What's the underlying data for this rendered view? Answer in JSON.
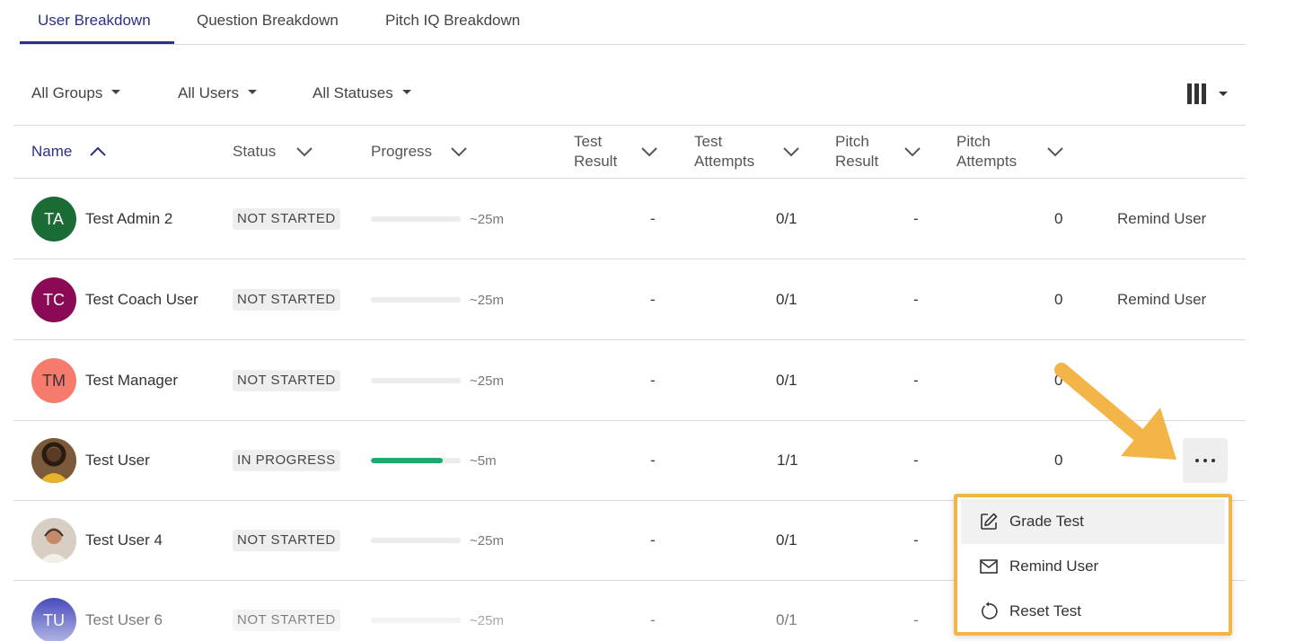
{
  "tabs": [
    {
      "label": "User Breakdown",
      "active": true
    },
    {
      "label": "Question Breakdown",
      "active": false
    },
    {
      "label": "Pitch IQ Breakdown",
      "active": false
    }
  ],
  "filters": {
    "groups": "All Groups",
    "users": "All Users",
    "statuses": "All Statuses"
  },
  "columns": {
    "name": "Name",
    "status": "Status",
    "progress": "Progress",
    "test_result_1": "Test",
    "test_result_2": "Result",
    "test_attempts_1": "Test",
    "test_attempts_2": "Attempts",
    "pitch_result_1": "Pitch",
    "pitch_result_2": "Result",
    "pitch_attempts_1": "Pitch",
    "pitch_attempts_2": "Attempts"
  },
  "rows": [
    {
      "initials": "TA",
      "name": "Test Admin 2",
      "avatar_color": "#1b6b34",
      "status": "NOT STARTED",
      "progress": 0,
      "time": "~25m",
      "test_result": "-",
      "test_attempts": "0/1",
      "pitch_result": "-",
      "pitch_attempts": "0",
      "action": "Remind User"
    },
    {
      "initials": "TC",
      "name": "Test Coach User",
      "avatar_color": "#8a0a55",
      "status": "NOT STARTED",
      "progress": 0,
      "time": "~25m",
      "test_result": "-",
      "test_attempts": "0/1",
      "pitch_result": "-",
      "pitch_attempts": "0",
      "action": "Remind User"
    },
    {
      "initials": "TM",
      "name": "Test Manager",
      "avatar_color": "#f77b6c",
      "status": "NOT STARTED",
      "progress": 0,
      "time": "~25m",
      "test_result": "-",
      "test_attempts": "0/1",
      "pitch_result": "-",
      "pitch_attempts": "0",
      "action": ""
    },
    {
      "initials": "",
      "name": "Test User",
      "avatar_color": "#c98a2e",
      "status": "IN PROGRESS",
      "progress": 0.8,
      "time": "~5m",
      "test_result": "-",
      "test_attempts": "1/1",
      "pitch_result": "-",
      "pitch_attempts": "0",
      "action": ""
    },
    {
      "initials": "",
      "name": "Test User 4",
      "avatar_color": "#c9b9a8",
      "status": "NOT STARTED",
      "progress": 0,
      "time": "~25m",
      "test_result": "-",
      "test_attempts": "0/1",
      "pitch_result": "-",
      "pitch_attempts": "",
      "action": ""
    },
    {
      "initials": "TU",
      "name": "Test User 6",
      "avatar_color": "#3a3fb8",
      "status": "NOT STARTED",
      "progress": 0,
      "time": "~25m",
      "test_result": "-",
      "test_attempts": "0/1",
      "pitch_result": "-",
      "pitch_attempts": "",
      "action": ""
    }
  ],
  "menu": {
    "grade_test": "Grade Test",
    "remind_user": "Remind User",
    "reset_test": "Reset Test"
  },
  "colors": {
    "accent": "#2b2f8a",
    "progress_fill": "#1fa971",
    "highlight": "#f4b548"
  }
}
